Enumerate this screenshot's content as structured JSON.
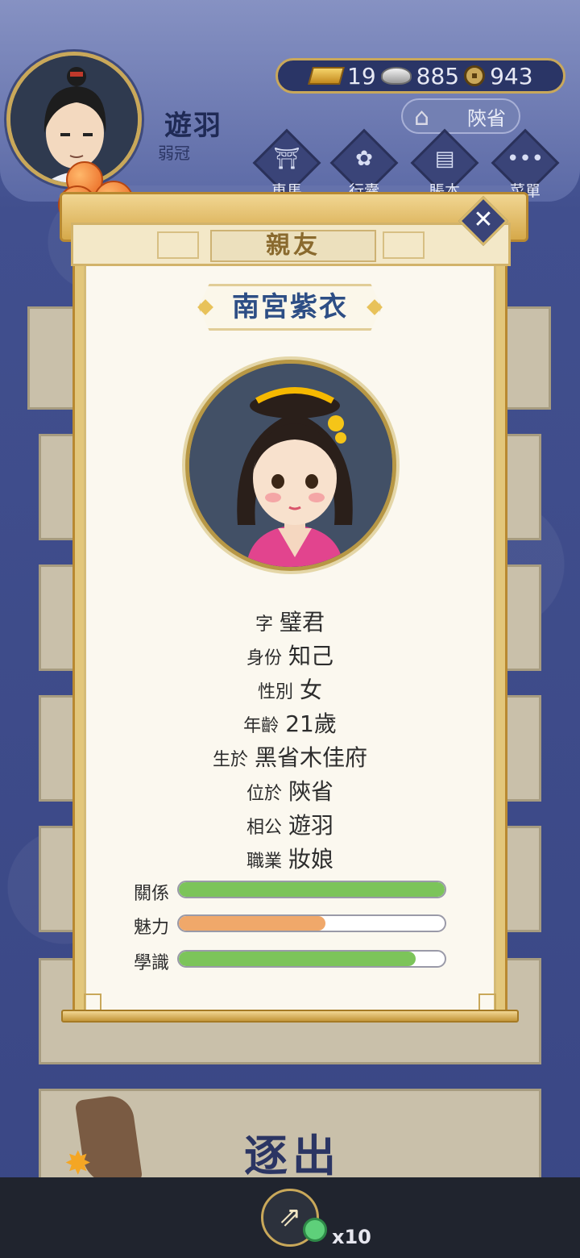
{
  "player": {
    "name": "遊羽",
    "title": "弱冠"
  },
  "currency": {
    "gold": "19",
    "silver": "885",
    "coins": "943"
  },
  "location": "陝省",
  "nav": [
    {
      "label": "車馬",
      "icon": "carriage-icon"
    },
    {
      "label": "行囊",
      "icon": "bag-icon"
    },
    {
      "label": "賬本",
      "icon": "ledger-icon"
    },
    {
      "label": "菜單",
      "icon": "menu-icon"
    }
  ],
  "background": {
    "expel_label": "逐出"
  },
  "modal": {
    "title": "親友",
    "name": "南宮紫衣",
    "info": [
      {
        "key": "字",
        "value": "璧君"
      },
      {
        "key": "身份",
        "value": "知己"
      },
      {
        "key": "性別",
        "value": "女"
      },
      {
        "key": "年齡",
        "value": "21歲"
      },
      {
        "key": "生於",
        "value": "黑省木佳府"
      },
      {
        "key": "位於",
        "value": "陝省"
      },
      {
        "key": "相公",
        "value": "遊羽"
      },
      {
        "key": "職業",
        "value": "妝娘"
      }
    ],
    "stats": [
      {
        "label": "關係",
        "level": 1.0,
        "color": "#7cc45a"
      },
      {
        "label": "魅力",
        "level": 0.55,
        "color": "#f0a86a"
      },
      {
        "label": "學識",
        "level": 0.89,
        "color": "#7cc45a"
      }
    ]
  },
  "bottom": {
    "share_count": "x10"
  },
  "colors": {
    "accent_gold": "#c9a85a",
    "navy": "#3a4478",
    "name_blue": "#2d4e85"
  }
}
